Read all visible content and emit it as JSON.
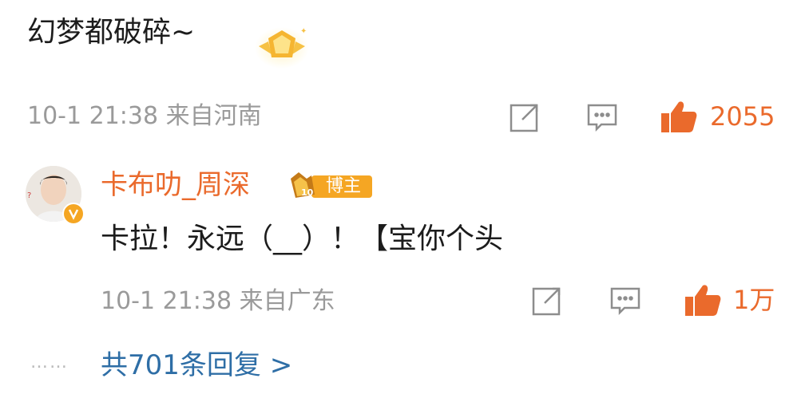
{
  "comment": {
    "text": "幻梦都破碎~",
    "meta": "10-1 21:38 来自河南",
    "likes": "2055",
    "icons": [
      "medal-badge-icon",
      "share-icon",
      "comment-icon",
      "thumbs-up-icon"
    ]
  },
  "reply": {
    "username": "卡布叻_周深",
    "host_badge_label": "博主",
    "host_badge_level": "10",
    "text": "卡拉！永远（__）！【宝你个头",
    "meta": "10-1 21:38 来自广东",
    "likes": "1万",
    "icons": [
      "avatar",
      "verified-badge-icon",
      "share-icon",
      "comment-icon",
      "thumbs-up-icon"
    ]
  },
  "replies_link": {
    "dots": "……",
    "label": "共701条回复 >"
  },
  "colors": {
    "accent_orange": "#ea6a2c",
    "link_blue": "#2e6ea6",
    "meta_gray": "#9a9a9a"
  }
}
